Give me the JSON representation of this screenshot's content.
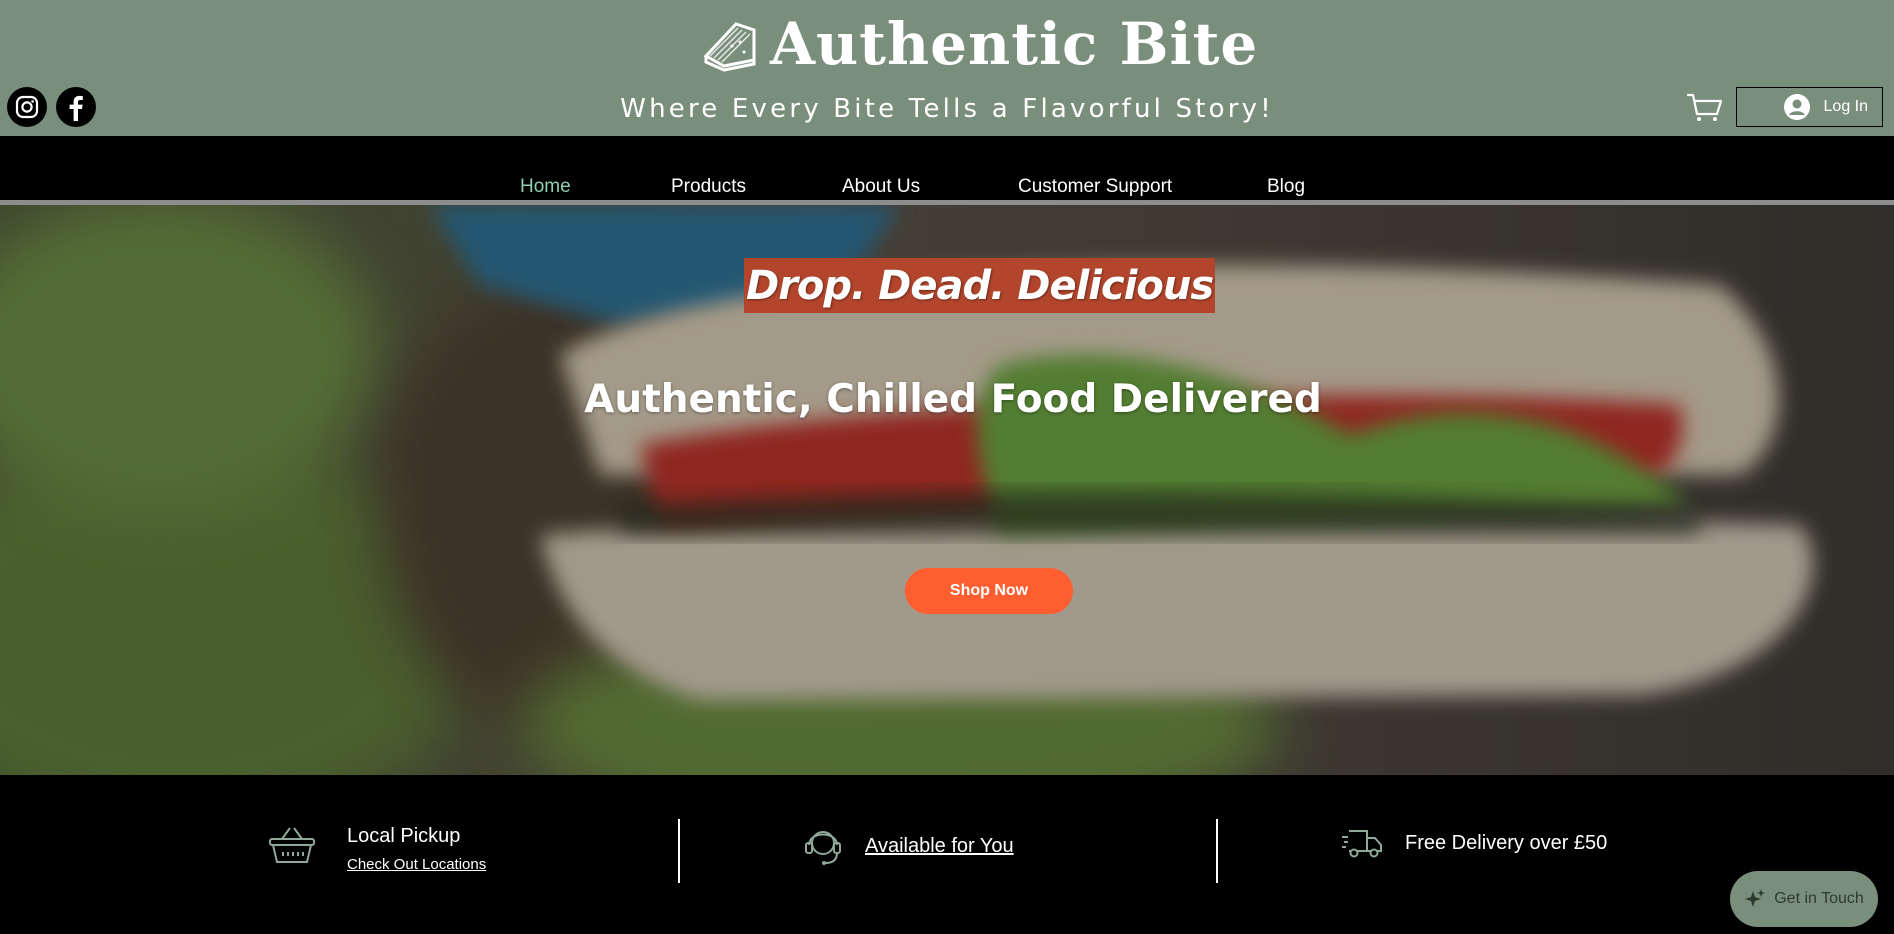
{
  "header": {
    "brand_name": "Authentic Bite",
    "tagline": "Where Every Bite Tells a Flavorful Story!",
    "logo_icon": "sandwich-logo",
    "social": [
      {
        "name": "instagram-icon"
      },
      {
        "name": "facebook-icon"
      }
    ],
    "cart_icon": "cart-icon",
    "login_label": "Log In"
  },
  "nav": {
    "items": [
      {
        "label": "Home",
        "active": true
      },
      {
        "label": "Products",
        "active": false
      },
      {
        "label": "About Us",
        "active": false
      },
      {
        "label": "Customer Support",
        "active": false
      },
      {
        "label": "Blog",
        "active": false
      }
    ]
  },
  "hero": {
    "headline": "Drop. Dead. Delicious",
    "subheadline": "Authentic, Chilled Food Delivered",
    "cta_label": "Shop Now"
  },
  "features": {
    "pickup_title": "Local Pickup",
    "pickup_link": "Check Out Locations",
    "support_link": "Available for You",
    "delivery_title": "Free Delivery over £50"
  },
  "chat": {
    "label": "Get in Touch"
  },
  "colors": {
    "header_bg": "#7a8f7b",
    "nav_active": "#8ed0b0",
    "headline_bg": "#b2452c",
    "cta_bg": "#ff5f30",
    "chat_bg": "#7a8f7b"
  }
}
